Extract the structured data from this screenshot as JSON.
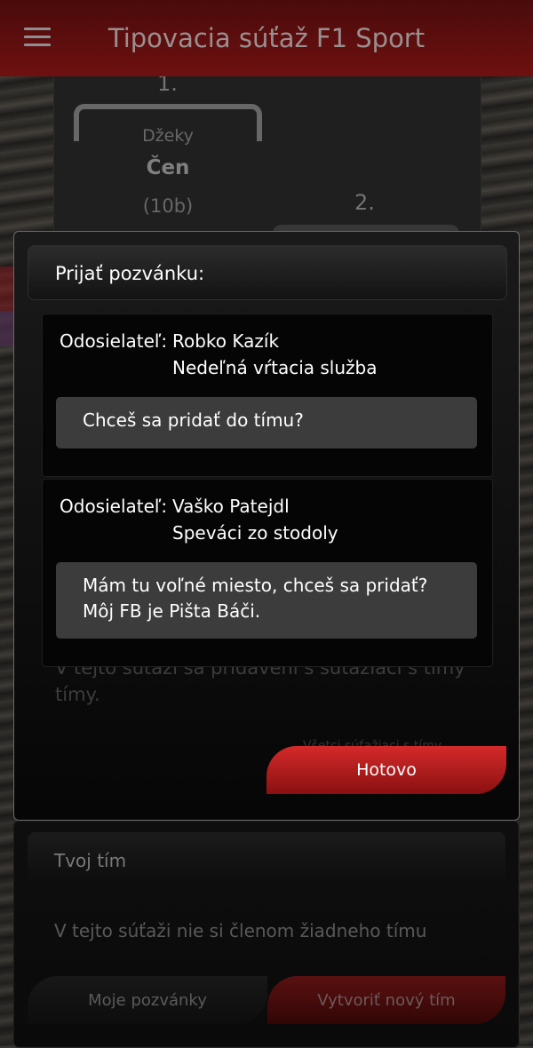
{
  "app": {
    "title": "Tipovacia súťaž F1 Sport"
  },
  "podium": {
    "first_rank": "1.",
    "second_rank": "2.",
    "first": {
      "team": "Džeky",
      "name": "Čen",
      "points": "(10b)"
    }
  },
  "modal": {
    "title": "Prijať pozvánku:",
    "sender_label": "Odosielateľ:",
    "invites": [
      {
        "sender": "Robko Kazík",
        "team": "Nedeľná vŕtacia služba",
        "message": "Chceš sa pridať do tímu?"
      },
      {
        "sender": "Vaško Patejdl",
        "team": "Speváci zo stodoly",
        "message_lines": [
          "Mám tu voľné miesto, chceš sa pridať?",
          "Môj FB je Pišta Báči."
        ]
      }
    ],
    "partially_hidden_text": [
      "V tejto súťaži sa pridávení s súťažiaci s tímy",
      "tímy."
    ],
    "hidden_link": "Všetci súťažiaci s tímy",
    "done_label": "Hotovo"
  },
  "team_section": {
    "title": "Tvoj tím",
    "empty_text": "V tejto súťaži nie si členom žiadneho tímu",
    "invites_button": "Moje pozvánky",
    "create_button": "Vytvoriť nový tím"
  },
  "colors": {
    "accent": "#c62222",
    "header": "#5c0d0d"
  }
}
